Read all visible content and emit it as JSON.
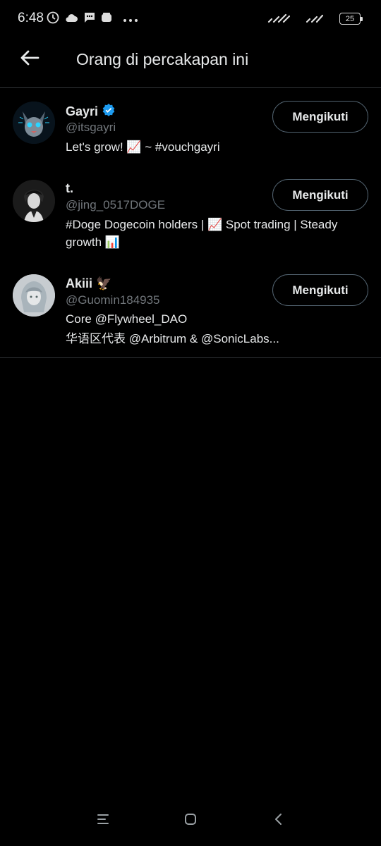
{
  "status_bar": {
    "time": "6:48",
    "battery": "25",
    "left_icons": [
      "clock-icon",
      "cloud-icon",
      "message-icon",
      "wallet-icon",
      "more-dots-icon"
    ],
    "right_icons": [
      "signal-icon",
      "signal-icon",
      "battery-icon"
    ]
  },
  "header": {
    "title": "Orang di percakapan ini",
    "back_icon": "arrow-left-icon"
  },
  "people": [
    {
      "name": "Gayri",
      "verified": true,
      "handle": "@itsgayri",
      "bio": "Let's grow! 📈 ~ #vouchgayri",
      "button": "Mengikuti"
    },
    {
      "name": "t.",
      "verified": false,
      "handle": "@jing_0517DOGE",
      "bio": "#Doge Dogecoin holders | 📈 Spot trading | Steady growth 📊",
      "button": "Mengikuti"
    },
    {
      "name": "Akiii 🦅",
      "verified": false,
      "handle": "@Guomin184935",
      "bio_line1": "Core @Flywheel_DAO",
      "bio_line2": "华语区代表 @Arbitrum & @SonicLabs...",
      "button": "Mengikuti"
    }
  ],
  "colors": {
    "background": "#000000",
    "text": "#e7e9ea",
    "secondary_text": "#71767b",
    "divider": "#2f3336",
    "verified": "#1d9bf0"
  },
  "nav_bar": {
    "icons": [
      "recents-icon",
      "home-icon",
      "back-icon"
    ]
  }
}
